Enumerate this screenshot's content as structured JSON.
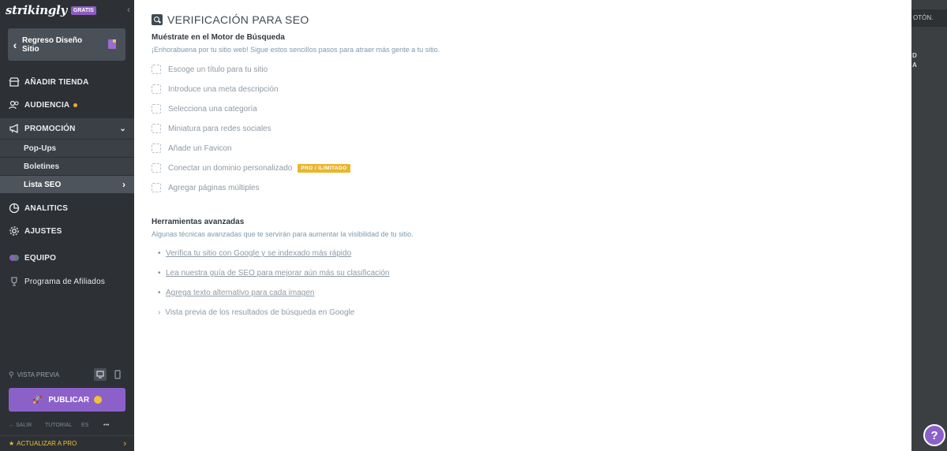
{
  "brand": {
    "logo": "strikingly",
    "badge": "GRATIS"
  },
  "back": {
    "label": "Regreso Diseño Sitio"
  },
  "nav": {
    "tienda": "AÑADIR TIENDA",
    "audiencia": "AUDIENCIA",
    "promocion": "PROMOCIÓN",
    "popups": "Pop-Ups",
    "boletines": "Boletines",
    "lista_seo": "Lista SEO",
    "analitics": "ANALITICS",
    "ajustes": "AJUSTES",
    "equipo": "EQUIPO",
    "afiliados": "Programa de Afiliados"
  },
  "preview": {
    "label": "VISTA PREVIA"
  },
  "publish": {
    "label": "PUBLICAR"
  },
  "footer": {
    "salir": "SALIR",
    "tutorial": "TUTORIAL",
    "lang": "ES",
    "more": "•••"
  },
  "upgrade": {
    "label": "ACTUALIZAR A PRO"
  },
  "main": {
    "title": "VERIFICACIÓN PARA SEO",
    "section1_title": "Muéstrate en el Motor de Búsqueda",
    "section1_desc": "¡Enhorabuena por tu sitio web! Sigue estos sencillos pasos para atraer más gente a tu sitio.",
    "checklist": [
      "Escoge un título para tu sitio",
      "Introduce una meta descripción",
      "Selecciona una categoría",
      "Miniatura para redes sociales",
      "Añade un Favicon",
      "Conectar un dominio personalizado",
      "Agregar páginas múltiples"
    ],
    "pro_badge": "PRO / ILIMITADO",
    "section2_title": "Herramientas avanzadas",
    "section2_desc": "Algunas técnicas avanzadas que te servirán para aumentar la visibilidad de tu sitio.",
    "links": [
      "Verifica tu sitio con Google y se indexado más rápido",
      "Lea nuestra guía de SEO para mejorar aún más su clasificación",
      "Agrega texto alternativo para cada imagen"
    ],
    "expander": "Vista previa de los resultados de búsqueda en Google"
  },
  "right": {
    "boton": "OTÓN.",
    "t1": "D",
    "t2": "A"
  },
  "help": {
    "label": "?"
  },
  "colors": {
    "accent": "#8b61c9",
    "sidebar": "#2d3136",
    "pro": "#e9b62f"
  }
}
